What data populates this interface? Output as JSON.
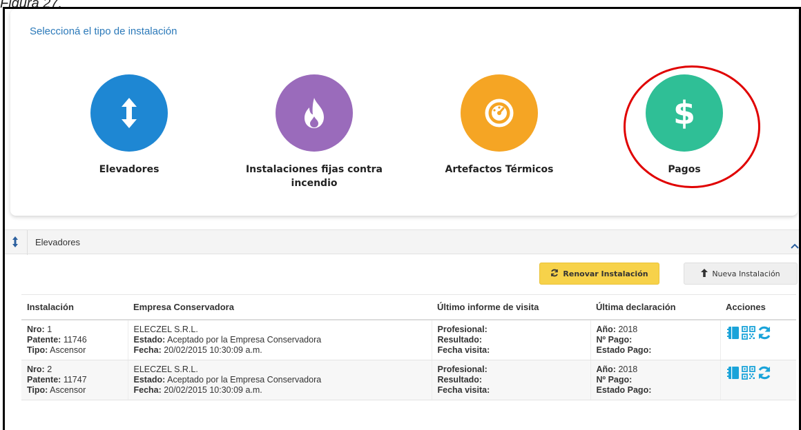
{
  "caption": "Figura 27.",
  "types": {
    "title": "Seleccioná el tipo de instalación",
    "items": [
      {
        "label": "Elevadores",
        "color": "#1e87d3",
        "icon": "up-down-arrow-icon"
      },
      {
        "label": "Instalaciones fijas contra incendio",
        "color": "#9a6bbb",
        "icon": "fire-icon"
      },
      {
        "label": "Artefactos Térmicos",
        "color": "#f5a524",
        "icon": "gauge-icon"
      },
      {
        "label": "Pagos",
        "color": "#2fbf96",
        "icon": "dollar-icon"
      }
    ],
    "highlight_color": "#e00000"
  },
  "accordion": {
    "title": "Elevadores"
  },
  "toolbar": {
    "renovar": "Renovar Instalación",
    "nueva": "Nueva Instalación"
  },
  "table": {
    "headers": [
      "Instalación",
      "Empresa Conservadora",
      "Último informe de visita",
      "Última declaración",
      "Acciones"
    ],
    "labels": {
      "nro": "Nro:",
      "patente": "Patente:",
      "tipo": "Tipo:",
      "estado": "Estado:",
      "fecha": "Fecha:",
      "profesional": "Profesional:",
      "resultado": "Resultado:",
      "fecha_visita": "Fecha visita:",
      "anio": "Año:",
      "nro_pago": "Nº Pago:",
      "estado_pago": "Estado Pago:"
    },
    "rows": [
      {
        "nro": "1",
        "patente": "11746",
        "tipo": "Ascensor",
        "empresa": "ELECZEL S.R.L.",
        "estado": "Aceptado por la Empresa Conservadora",
        "fecha": "20/02/2015 10:30:09 a.m.",
        "anio": "2018"
      },
      {
        "nro": "2",
        "patente": "11747",
        "tipo": "Ascensor",
        "empresa": "ELECZEL S.R.L.",
        "estado": "Aceptado por la Empresa Conservadora",
        "fecha": "20/02/2015 10:30:09 a.m.",
        "anio": "2018"
      }
    ],
    "action_icons": [
      "notebook-icon",
      "qr-code-icon",
      "refresh-icon"
    ],
    "action_color": "#1aa3d9"
  }
}
